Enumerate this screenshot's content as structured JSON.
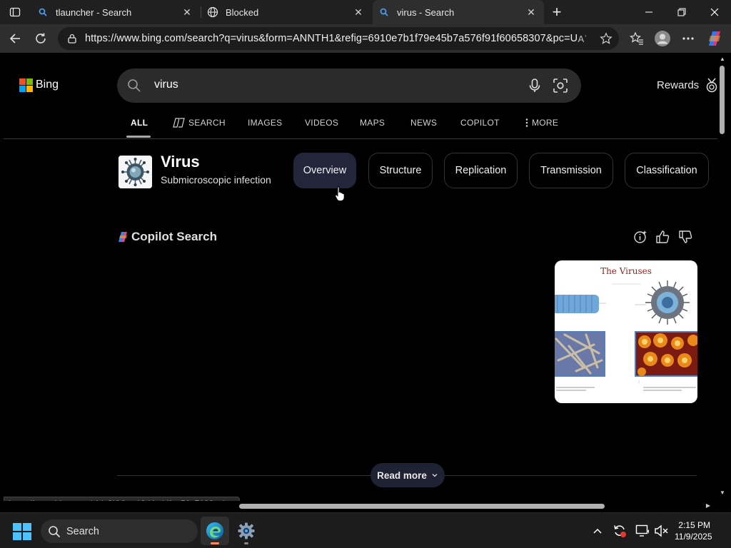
{
  "browser": {
    "tabs": [
      {
        "title": "tlauncher - Search",
        "icon": "bing-search-icon",
        "active": false
      },
      {
        "title": "Blocked",
        "icon": "globe-icon",
        "active": false
      },
      {
        "title": "virus - Search",
        "icon": "bing-search-icon",
        "active": true
      }
    ],
    "close_glyph": "✕",
    "new_tab_glyph": "+",
    "url": "https://www.bing.com/search?q=virus&form=ANNTH1&refig=6910e7b1f79e45b7a576f91f60658307&pc=U5...",
    "read_aloud_glyph": "Aʾ"
  },
  "bing": {
    "logo_text": "Bing",
    "logo_colors": [
      "#f25022",
      "#7fba00",
      "#00a4ef",
      "#ffb900"
    ],
    "query": "virus",
    "rewards_label": "Rewards",
    "nav": [
      {
        "label": "ALL",
        "active": true
      },
      {
        "label": "SEARCH",
        "active": false
      },
      {
        "label": "IMAGES",
        "active": false
      },
      {
        "label": "VIDEOS",
        "active": false
      },
      {
        "label": "MAPS",
        "active": false
      },
      {
        "label": "NEWS",
        "active": false
      },
      {
        "label": "COPILOT",
        "active": false
      },
      {
        "label": "MORE",
        "active": false
      }
    ],
    "entity": {
      "title": "Virus",
      "subtitle": "Submicroscopic infection",
      "pills": [
        {
          "label": "Overview",
          "active": true
        },
        {
          "label": "Structure",
          "active": false
        },
        {
          "label": "Replication",
          "active": false
        },
        {
          "label": "Transmission",
          "active": false
        },
        {
          "label": "Classification",
          "active": false
        }
      ]
    },
    "copilot": {
      "title": "Copilot Search",
      "figure_title": "The Viruses",
      "read_more_label": "Read more"
    },
    "status_url": "https://www.bing.com/ck/a?!&&p=13d4cddfae59c7108ceb..."
  },
  "taskbar": {
    "search_label": "Search",
    "time": "2:15 PM",
    "date": "11/9/2025",
    "accent": "#4cc2ff"
  }
}
